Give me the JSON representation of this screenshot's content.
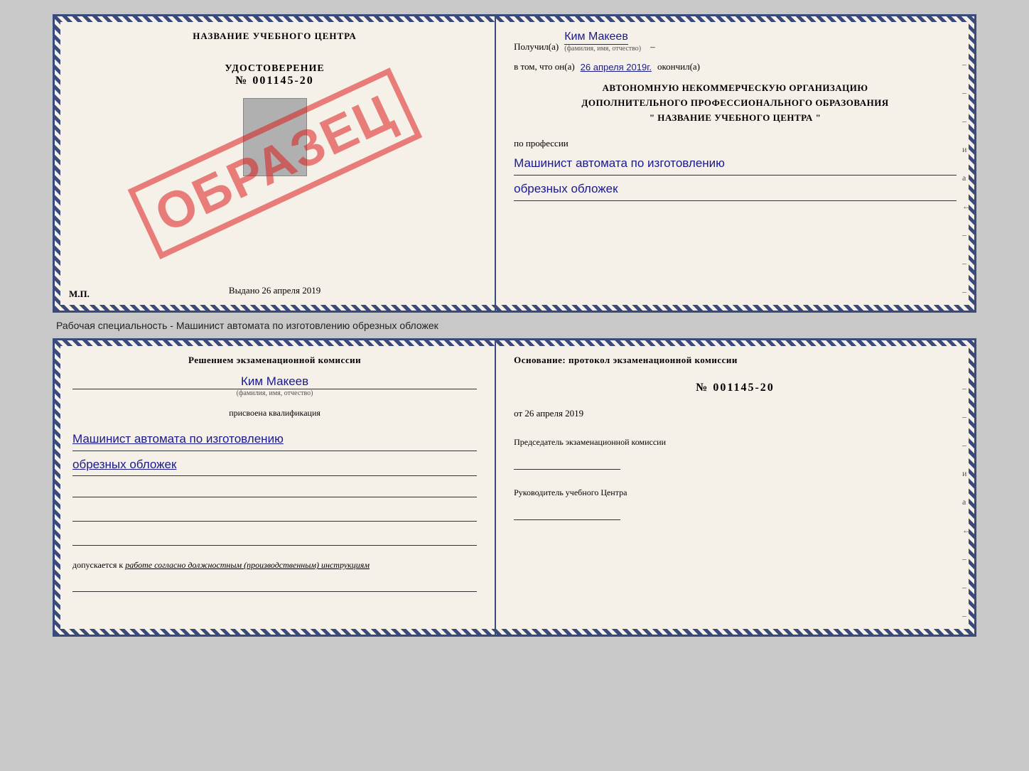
{
  "top_diploma": {
    "left": {
      "school_name": "НАЗВАНИЕ УЧЕБНОГО ЦЕНТРА",
      "cert_label": "УДОСТОВЕРЕНИЕ",
      "cert_number": "№ 001145-20",
      "issued_label": "Выдано",
      "issued_date": "26 апреля 2019",
      "mp_label": "М.П.",
      "stamp_text": "ОБРАЗЕЦ"
    },
    "right": {
      "recipient_prefix": "Получил(а)",
      "recipient_name": "Ким Макеев",
      "fio_hint": "(фамилия, имя, отчество)",
      "date_prefix": "в том, что он(а)",
      "date_value": "26 апреля 2019г.",
      "date_suffix": "окончил(а)",
      "org_line1": "АВТОНОМНУЮ НЕКОММЕРЧЕСКУЮ ОРГАНИЗАЦИЮ",
      "org_line2": "ДОПОЛНИТЕЛЬНОГО ПРОФЕССИОНАЛЬНОГО ОБРАЗОВАНИЯ",
      "org_line3": "\"  НАЗВАНИЕ УЧЕБНОГО ЦЕНТРА  \"",
      "profession_label": "по профессии",
      "profession_line1": "Машинист автомата по изготовлению",
      "profession_line2": "обрезных обложек",
      "side_dashes": [
        "–",
        "–",
        "–",
        "и",
        "а",
        "←",
        "–",
        "–",
        "–",
        "–"
      ]
    }
  },
  "caption": {
    "text": "Рабочая специальность - Машинист автомата по изготовлению обрезных обложек"
  },
  "bottom_diploma": {
    "left": {
      "commission_text": "Решением экзаменационной комиссии",
      "person_name": "Ким Макеев",
      "fio_hint": "(фамилия, имя, отчество)",
      "qualification_label": "присвоена квалификация",
      "qualification_line1": "Машинист автомата по изготовлению",
      "qualification_line2": "обрезных обложек",
      "допускается_prefix": "допускается к",
      "допускается_text": "работе согласно должностным (производственным) инструкциям"
    },
    "right": {
      "basis_label": "Основание: протокол экзаменационной комиссии",
      "protocol_number": "№ 001145-20",
      "protocol_date_prefix": "от",
      "protocol_date": "26 апреля 2019",
      "chairman_title": "Председатель экзаменационной комиссии",
      "director_title": "Руководитель учебного Центра",
      "side_dashes": [
        "–",
        "–",
        "–",
        "и",
        "а",
        "←",
        "–",
        "–",
        "–",
        "–"
      ]
    }
  }
}
